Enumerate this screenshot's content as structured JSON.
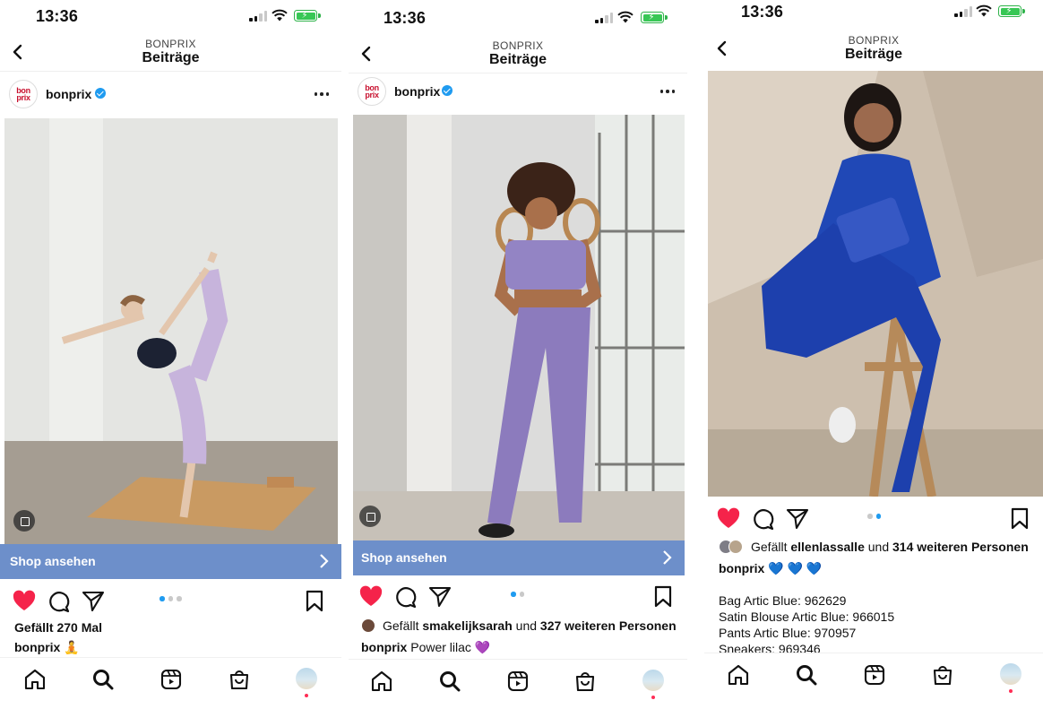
{
  "screens": [
    {
      "status": {
        "time": "13:36"
      },
      "header": {
        "account_upper": "BONPRIX",
        "title": "Beiträge"
      },
      "post": {
        "account": "bonprix",
        "shop_label": "Shop ansehen",
        "likes_prefix": "Gefällt 270 Mal",
        "caption_user": "bonprix",
        "caption_text": "🧘",
        "carousel_total": 3,
        "carousel_active": 1
      }
    },
    {
      "status": {
        "time": "13:36"
      },
      "header": {
        "account_upper": "BONPRIX",
        "title": "Beiträge"
      },
      "post": {
        "account": "bonprix",
        "shop_label": "Shop ansehen",
        "likes_prefix": "Gefällt ",
        "likes_user": "smakelijksarah",
        "likes_mid": " und ",
        "likes_count": "327 weiteren Personen",
        "caption_user": "bonprix",
        "caption_text": " Power lilac 💜",
        "carousel_total": 2,
        "carousel_active": 1
      }
    },
    {
      "status": {
        "time": "13:36"
      },
      "header": {
        "account_upper": "BONPRIX",
        "title": "Beiträge"
      },
      "post": {
        "likes_prefix": "Gefällt ",
        "likes_user": "ellenlassalle",
        "likes_mid": " und ",
        "likes_count": "314 weiteren Personen",
        "caption_user": "bonprix",
        "caption_text": " 💙 💙 💙",
        "description_lines": [
          "Bag Artic Blue: 962629",
          "Satin Blouse Artic Blue: 966015",
          "Pants Artic Blue: 970957",
          "Sneakers: 969346"
        ],
        "carousel_total": 2,
        "carousel_active": 2
      }
    }
  ],
  "icons": {
    "back": "chevron-left-icon",
    "verified": "verified-badge-icon",
    "more": "more-horizontal-icon",
    "like": "heart-filled-icon",
    "comment": "comment-icon",
    "share": "paper-plane-icon",
    "save": "bookmark-icon",
    "home": "home-icon",
    "search": "search-icon",
    "reels": "reels-icon",
    "shop": "shopping-bag-icon",
    "profile": "profile-avatar-icon"
  },
  "colors": {
    "heart": "#f5234a",
    "accent_blue": "#1f9bf0",
    "shop_bar": "#6d8fca",
    "battery_green": "#38c755",
    "notification_red": "#ff2d55"
  }
}
